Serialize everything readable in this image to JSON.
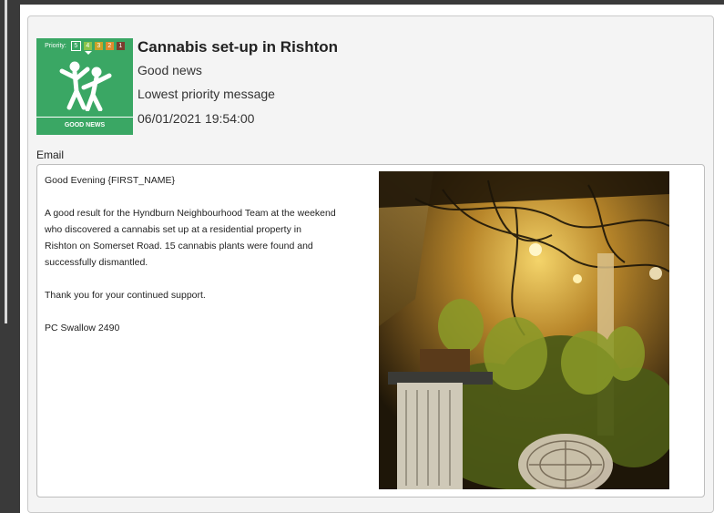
{
  "badge": {
    "priority_label": "Priority:",
    "levels": [
      "5",
      "4",
      "3",
      "2",
      "1"
    ],
    "level_colors": [
      "#3aa764",
      "#8bc34a",
      "#c9a227",
      "#e08a2d",
      "#7a3b2e"
    ],
    "caption": "GOOD NEWS",
    "color": "#3aa764"
  },
  "message": {
    "title": "Cannabis set-up in Rishton",
    "category": "Good news",
    "priority": "Lowest priority message",
    "datetime": "06/01/2021 19:54:00"
  },
  "email": {
    "section_label": "Email",
    "greeting": "Good Evening {FIRST_NAME}",
    "body": "A good result for the Hyndburn Neighbourhood Team at the weekend who discovered a cannabis set up at a residential property in Rishton on Somerset Road. 15 cannabis plants were found and successfully dismantled.",
    "thanks": "Thank you for your continued support.",
    "signature": "PC Swallow 2490"
  }
}
